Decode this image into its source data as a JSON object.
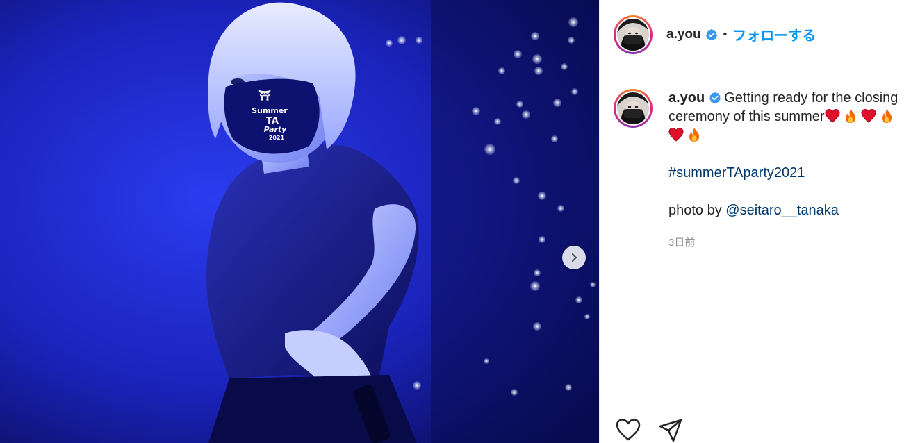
{
  "post": {
    "username": "a.you",
    "follow_label": "フォローする",
    "separator": "•",
    "caption": {
      "line1": "Getting ready for the closing ceremony of this summer",
      "emojis": [
        "heart",
        "fire",
        "heart",
        "fire",
        "heart",
        "fire"
      ],
      "hashtag": "#summerTAparty2021",
      "photo_prefix": "photo by ",
      "photo_credit": "@seitaro__tanaka"
    },
    "timestamp": "3日前"
  },
  "photo": {
    "mask_text_line1": "Summer",
    "mask_text_line2": "TA",
    "mask_text_line3": "Party",
    "mask_text_line4": "2021"
  },
  "colors": {
    "accent": "#0095f6",
    "text": "#262626",
    "muted": "#8e8e8e",
    "link": "#00376b",
    "photo_bg": "#06083a"
  },
  "icons": [
    "chevron-right-icon",
    "verified-badge-icon",
    "heart-icon",
    "share-icon"
  ]
}
